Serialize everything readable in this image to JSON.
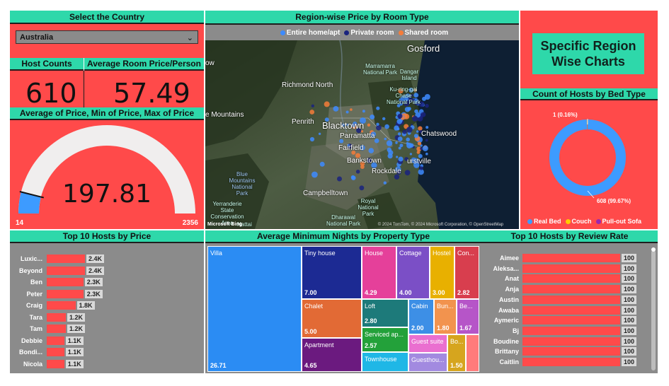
{
  "country_slicer": {
    "title": "Select the Country",
    "selected": "Australia"
  },
  "kpis": {
    "host_counts_label": "Host Counts",
    "host_counts_value": "610",
    "avg_price_label": "Average Room Price/Person",
    "avg_price_value": "57.49"
  },
  "gauge": {
    "title": "Average of Price, Min of Price, Max of Price",
    "value_text": "197.81",
    "min_text": "14",
    "max_text": "2356",
    "value": 197.81,
    "min": 14,
    "max": 2356
  },
  "map": {
    "title": "Region-wise Price by Room Type",
    "legend": [
      {
        "label": "Entire home/apt",
        "color": "#3d8bff"
      },
      {
        "label": "Private room",
        "color": "#1a237e"
      },
      {
        "label": "Shared room",
        "color": "#f57c3a"
      }
    ],
    "places": {
      "gosford": "Gosford",
      "richmond": "Richmond North",
      "mountains": "e Mountains",
      "penrith": "Penrith",
      "blacktown": "Blacktown",
      "parramatta": "Parramatta",
      "fairfield": "Fairfield",
      "bankstown": "Bankstown",
      "rockdale": "Rockdale",
      "campbelltown": "Campbelltown",
      "chatswood": "Chatswood",
      "hurstville": "urstville",
      "ow": "ow",
      "marramarra": "Marramarra National Park",
      "dangar": "Dangar Island",
      "kuringgai": "Ku-ring-gai Chase National Park",
      "blue_mtns": "Blue Mountains National Park",
      "royal": "Royal National Park",
      "yerranderie": "Yerranderie State Conservation Area",
      "nattai": "Nattai",
      "dharawal": "Dharawal National Park"
    },
    "footer_brand": "Microsoft Bing",
    "attribution": "© 2024 TomTom, © 2024 Microsoft Corporation, © OpenStreetMap"
  },
  "side_title": "Specific Region Wise Charts",
  "donut": {
    "title": "Count of Hosts by Bed Type",
    "label_small": "1 (0.16%)",
    "label_big": "608 (99.67%)",
    "legend": [
      {
        "label": "Real Bed",
        "color": "#3d9bff"
      },
      {
        "label": "Couch",
        "color": "#ffcc00"
      },
      {
        "label": "Pull-out Sofa",
        "color": "#9b27b0"
      }
    ],
    "slices": [
      {
        "label": "Real Bed",
        "value": 608
      },
      {
        "label": "Couch",
        "value": 1
      },
      {
        "label": "Pull-out Sofa",
        "value": 1
      }
    ]
  },
  "top_price": {
    "title": "Top 10 Hosts by Price",
    "rows": [
      {
        "name": "Luxic...",
        "value": 2400,
        "label": "2.4K"
      },
      {
        "name": "Beyond",
        "value": 2400,
        "label": "2.4K"
      },
      {
        "name": "Ben",
        "value": 2300,
        "label": "2.3K"
      },
      {
        "name": "Peter",
        "value": 2300,
        "label": "2.3K"
      },
      {
        "name": "Craig",
        "value": 1800,
        "label": "1.8K"
      },
      {
        "name": "Tara",
        "value": 1200,
        "label": "1.2K"
      },
      {
        "name": "Tam",
        "value": 1200,
        "label": "1.2K"
      },
      {
        "name": "Debbie",
        "value": 1100,
        "label": "1.1K"
      },
      {
        "name": "Bondi...",
        "value": 1100,
        "label": "1.1K"
      },
      {
        "name": "Nicola",
        "value": 1100,
        "label": "1.1K"
      }
    ]
  },
  "treemap": {
    "title": "Average Minimum Nights by Property Type",
    "cells": [
      {
        "label": "Villa",
        "value": "26.71",
        "color": "#2b8cf3"
      },
      {
        "label": "Tiny house",
        "value": "7.00",
        "color": "#1c2a93"
      },
      {
        "label": "House",
        "value": "4.29",
        "color": "#e5409a"
      },
      {
        "label": "Cottage",
        "value": "4.00",
        "color": "#7b4fc6"
      },
      {
        "label": "Hostel",
        "value": "3.00",
        "color": "#e8b000"
      },
      {
        "label": "Con...",
        "value": "2.82",
        "color": "#d83e4e"
      },
      {
        "label": "Chalet",
        "value": "5.00",
        "color": "#e26a35"
      },
      {
        "label": "Loft",
        "value": "2.80",
        "color": "#1d7a7a"
      },
      {
        "label": "Cabin",
        "value": "2.00",
        "color": "#3d8fe6"
      },
      {
        "label": "Bun...",
        "value": "1.80",
        "color": "#f2934e"
      },
      {
        "label": "Be...",
        "value": "1.67",
        "color": "#b655c8"
      },
      {
        "label": "Apartment",
        "value": "4.65",
        "color": "#6b1a7f"
      },
      {
        "label": "Serviced ap...",
        "value": "2.57",
        "color": "#23a13a"
      },
      {
        "label": "Guest suite",
        "value": "",
        "color": "#ea6fd0"
      },
      {
        "label": "Townhouse",
        "value": "",
        "color": "#1fb7e6"
      },
      {
        "label": "Guesthou...",
        "value": "",
        "color": "#a28ae0"
      },
      {
        "label": "Bo...",
        "value": "1.50",
        "color": "#d6a51e"
      },
      {
        "label": "",
        "value": "",
        "color": "#ff7b7b"
      }
    ]
  },
  "top_review": {
    "title": "Top 10 Hosts by Review Rate",
    "rows": [
      {
        "name": "Aimee",
        "value": 100,
        "label": "100"
      },
      {
        "name": "Aleksa...",
        "value": 100,
        "label": "100"
      },
      {
        "name": "Anat",
        "value": 100,
        "label": "100"
      },
      {
        "name": "Anja",
        "value": 100,
        "label": "100"
      },
      {
        "name": "Austin",
        "value": 100,
        "label": "100"
      },
      {
        "name": "Awaba",
        "value": 100,
        "label": "100"
      },
      {
        "name": "Aymeric",
        "value": 100,
        "label": "100"
      },
      {
        "name": "Bj",
        "value": 100,
        "label": "100"
      },
      {
        "name": "Boudine",
        "value": 100,
        "label": "100"
      },
      {
        "name": "Brittany",
        "value": 100,
        "label": "100"
      },
      {
        "name": "Caitlin",
        "value": 100,
        "label": "100"
      }
    ]
  }
}
